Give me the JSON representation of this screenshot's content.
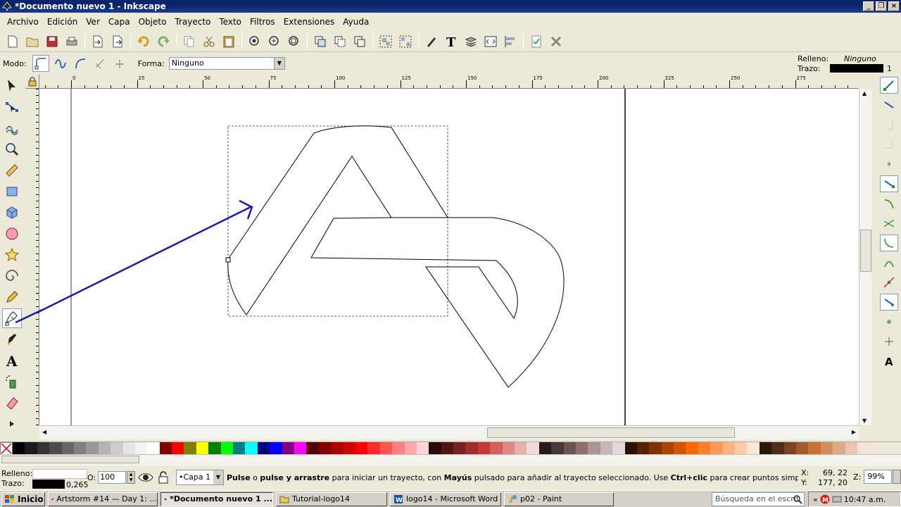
{
  "window": {
    "title": "*Documento nuevo 1 - Inkscape",
    "btn_min": "_",
    "btn_max": "❐",
    "btn_close": "×"
  },
  "menu": [
    "Archivo",
    "Edición",
    "Ver",
    "Capa",
    "Objeto",
    "Trayecto",
    "Texto",
    "Filtros",
    "Extensiones",
    "Ayuda"
  ],
  "toolctrl": {
    "mode_label": "Modo:",
    "shape_label": "Forma:",
    "shape_value": "Ninguno"
  },
  "fill_stroke_top": {
    "fill_label": "Relleno:",
    "fill_value": "Ninguno",
    "stroke_label": "Trazo:",
    "stroke_width": "1"
  },
  "ruler": {
    "top_labels": [
      "0",
      "25",
      "50",
      "75",
      "100",
      "125",
      "150",
      "175",
      "200",
      "225",
      "250",
      "275"
    ]
  },
  "palette": [
    "#000000",
    "#1a1a1a",
    "#333333",
    "#4d4d4d",
    "#666666",
    "#808080",
    "#999999",
    "#b3b3b3",
    "#cccccc",
    "#e6e6e6",
    "#f2f2f2",
    "#ffffff",
    "#800000",
    "#ff0000",
    "#808000",
    "#ffff00",
    "#008000",
    "#00ff00",
    "#008080",
    "#00ffff",
    "#000080",
    "#0000ff",
    "#800080",
    "#ff00ff",
    "#550000",
    "#800000",
    "#aa0000",
    "#d40000",
    "#ff0000",
    "#ff2a2a",
    "#ff5555",
    "#ff8080",
    "#ffaaaa",
    "#ffd5d5",
    "#280b0b",
    "#501616",
    "#782121",
    "#a02c2c",
    "#c83737",
    "#d35f5f",
    "#de8787",
    "#e9afaf",
    "#f4d7d7",
    "#241c1c",
    "#483737",
    "#6c5353",
    "#916f6f",
    "#ac9393",
    "#c8b7b7",
    "#e3dbdb",
    "#2b1100",
    "#552200",
    "#803300",
    "#aa4400",
    "#d45500",
    "#ff6600",
    "#ff7f2a",
    "#ff9955",
    "#ffb380",
    "#ffccaa",
    "#ffe6d5",
    "#28170b",
    "#502d16",
    "#784421",
    "#a05a2c",
    "#c87137",
    "#d38d5f",
    "#deaa87",
    "#e9c6af",
    "#f4e3d7"
  ],
  "status": {
    "fill_label": "Relleno:",
    "stroke_label": "Trazo:",
    "stroke_width": "0,265",
    "opacity_label": "O:",
    "opacity_value": "100",
    "layer": "•Capa 1",
    "msg_b1": "Pulse",
    "msg_t1": " o ",
    "msg_b2": "pulse y arrastre",
    "msg_t2": " para iniciar un trayecto, con ",
    "msg_b3": "Mayús",
    "msg_t3": " pulsado para añadir al trayecto seleccionado. Use ",
    "msg_b4": "Ctrl+clic",
    "msg_t4": " para crear puntos simples (solo en modo ...",
    "x_label": "X:",
    "x_value": "69, 22",
    "y_label": "Y:",
    "y_value": "177, 20",
    "zoom_label": "Z:",
    "zoom_value": "99%"
  },
  "taskbar": {
    "start": "Inicio",
    "tasks": [
      "Artstorm #14 — Day 1: ...",
      "*Documento nuevo 1 ...",
      "Tutorial-logo14",
      "logo14 - Microsoft Word",
      "p02 - Paint"
    ],
    "search_placeholder": "Búsqueda en el escrit",
    "clock": "10:47 a.m."
  }
}
